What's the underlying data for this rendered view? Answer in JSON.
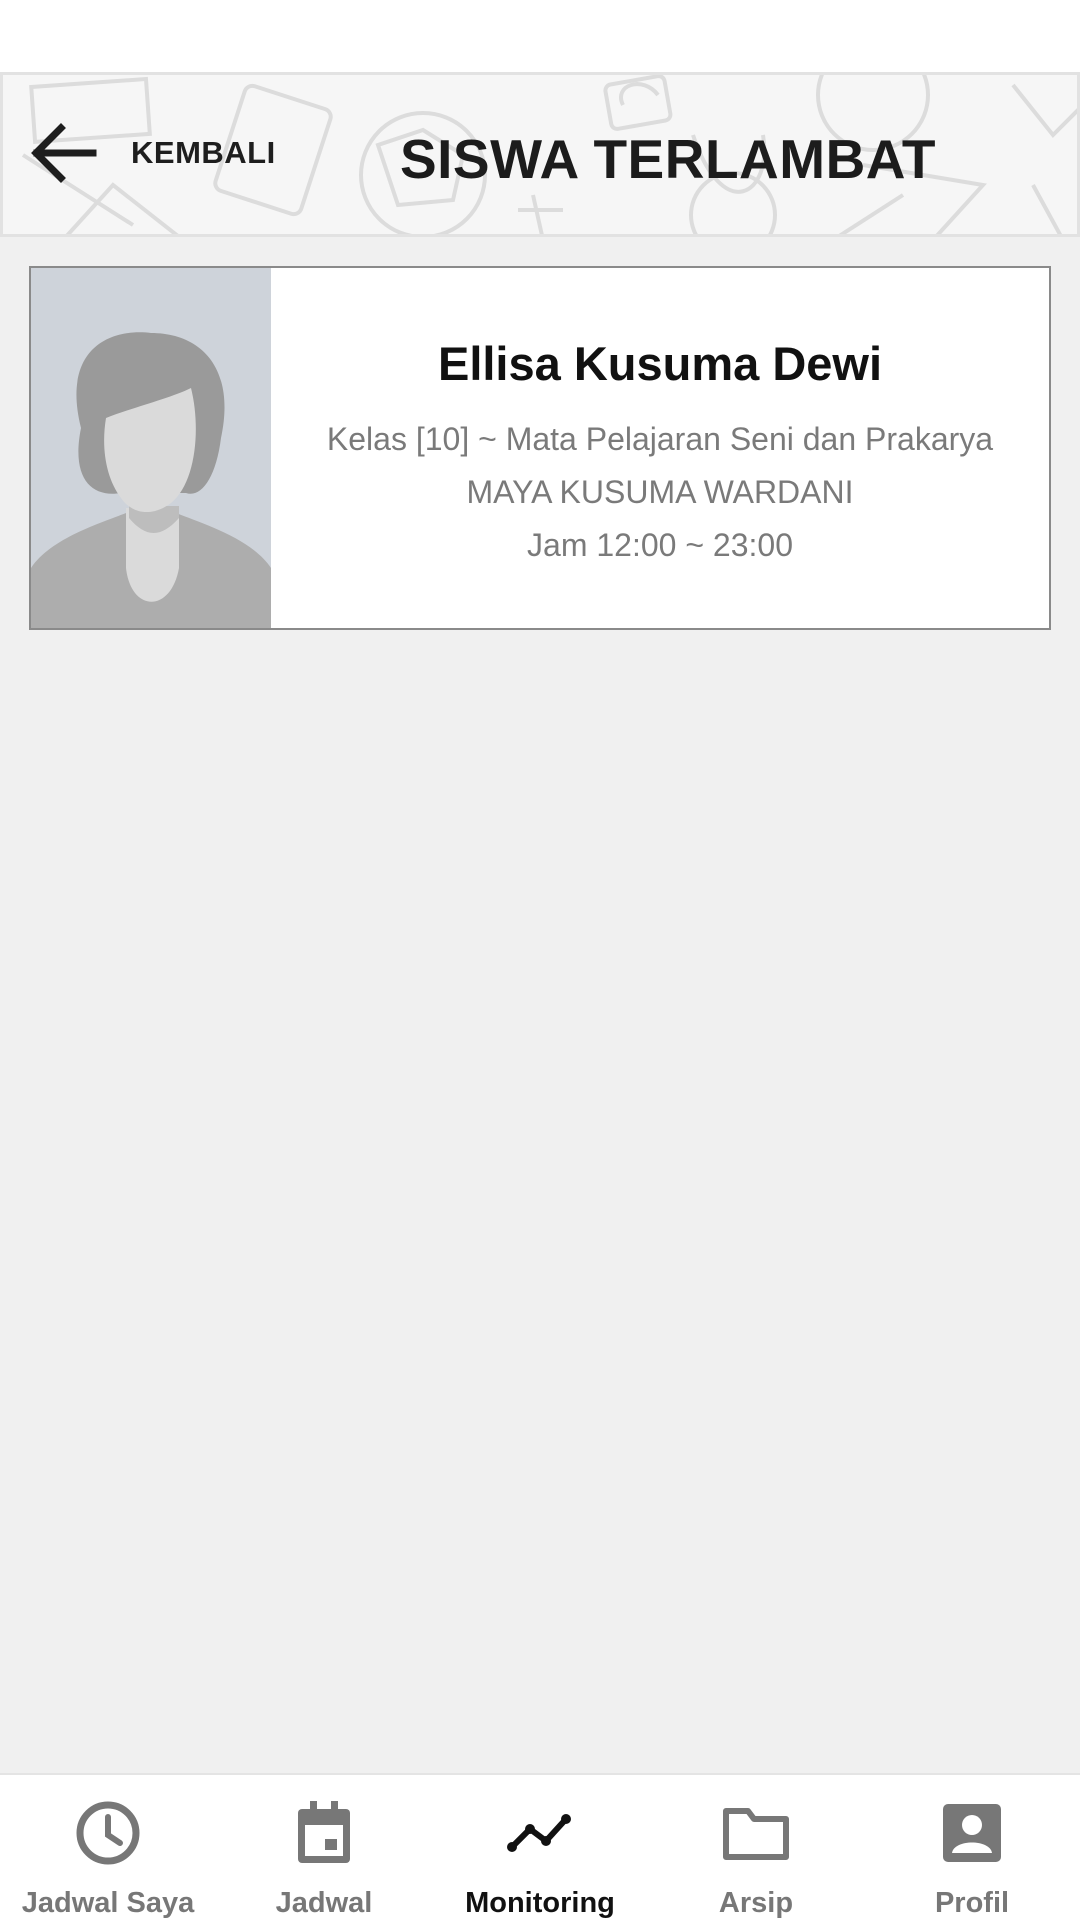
{
  "header": {
    "back_label": "KEMBALI",
    "title": "SISWA TERLAMBAT"
  },
  "students": [
    {
      "name": "Ellisa Kusuma Dewi",
      "class_subject": "Kelas [10] ~ Mata Pelajaran Seni dan Prakarya",
      "teacher": "MAYA KUSUMA WARDANI",
      "time": "Jam 12:00 ~ 23:00",
      "avatar_icon": "female-avatar-placeholder"
    }
  ],
  "bottom_nav": {
    "active": "Monitoring",
    "items": [
      {
        "label": "Jadwal Saya",
        "icon": "clock-icon"
      },
      {
        "label": "Jadwal",
        "icon": "calendar-icon"
      },
      {
        "label": "Monitoring",
        "icon": "trend-line-icon"
      },
      {
        "label": "Arsip",
        "icon": "folder-icon"
      },
      {
        "label": "Profil",
        "icon": "account-box-icon"
      }
    ]
  },
  "colors": {
    "page_background": "#f0f0f0",
    "header_background": "#f6f6f6",
    "inactive_nav": "#777777",
    "active_nav": "#111111",
    "avatar_background": "#ced3da"
  }
}
